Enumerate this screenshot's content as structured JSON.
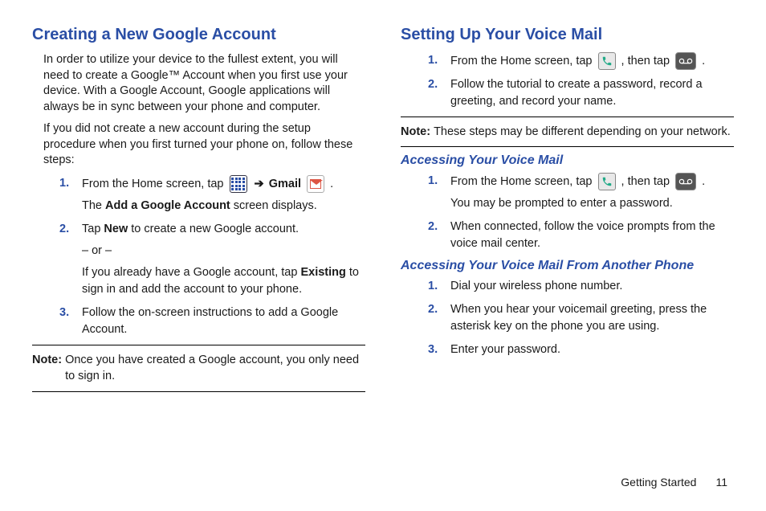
{
  "left": {
    "heading": "Creating a New Google Account",
    "para1": "In order to utilize your device to the fullest extent, you will need to create a Google™ Account when you first use your device. With a Google Account, Google applications will always be in sync between your phone and computer.",
    "para2": "If you did not create a new account during the setup procedure when you first turned your phone on, follow these steps:",
    "steps": [
      {
        "num": "1.",
        "pre": "From the Home screen, tap ",
        "arrow": "➔",
        "gmail_label": "Gmail",
        "period": " .",
        "sub": "The ",
        "sub_bold": "Add a Google Account",
        "sub_after": " screen displays."
      },
      {
        "num": "2.",
        "pre": "Tap ",
        "bold1": "New",
        "post1": " to create a new Google account.",
        "or": "– or –",
        "post2a": "If you already have a Google account, tap ",
        "bold2": "Existing",
        "post2b": " to sign in and add the account to your phone."
      },
      {
        "num": "3.",
        "text": "Follow the on-screen instructions to add a Google Account."
      }
    ],
    "note_label": "Note:",
    "note_text": "Once you have created a Google account, you only need to sign in."
  },
  "right": {
    "heading": "Setting Up Your Voice Mail",
    "steps_a": [
      {
        "num": "1.",
        "pre": "From the Home screen, tap ",
        "mid": ", then tap ",
        "post": " ."
      },
      {
        "num": "2.",
        "text": "Follow the tutorial to create a password, record a greeting, and record your name."
      }
    ],
    "note_label": "Note:",
    "note_text": "These steps may be different depending on your network.",
    "sub1": "Accessing Your Voice Mail",
    "steps_b": [
      {
        "num": "1.",
        "pre": "From the Home screen, tap ",
        "mid": ", then tap ",
        "post": " .",
        "sub": "You may be prompted to enter a password."
      },
      {
        "num": "2.",
        "text": "When connected, follow the voice prompts from the voice mail center."
      }
    ],
    "sub2": "Accessing Your Voice Mail From Another Phone",
    "steps_c": [
      {
        "num": "1.",
        "text": "Dial your wireless phone number."
      },
      {
        "num": "2.",
        "text": "When you hear your voicemail greeting, press the asterisk key on the phone you are using."
      },
      {
        "num": "3.",
        "text": "Enter your password."
      }
    ]
  },
  "footer": {
    "section": "Getting Started",
    "page": "11"
  }
}
